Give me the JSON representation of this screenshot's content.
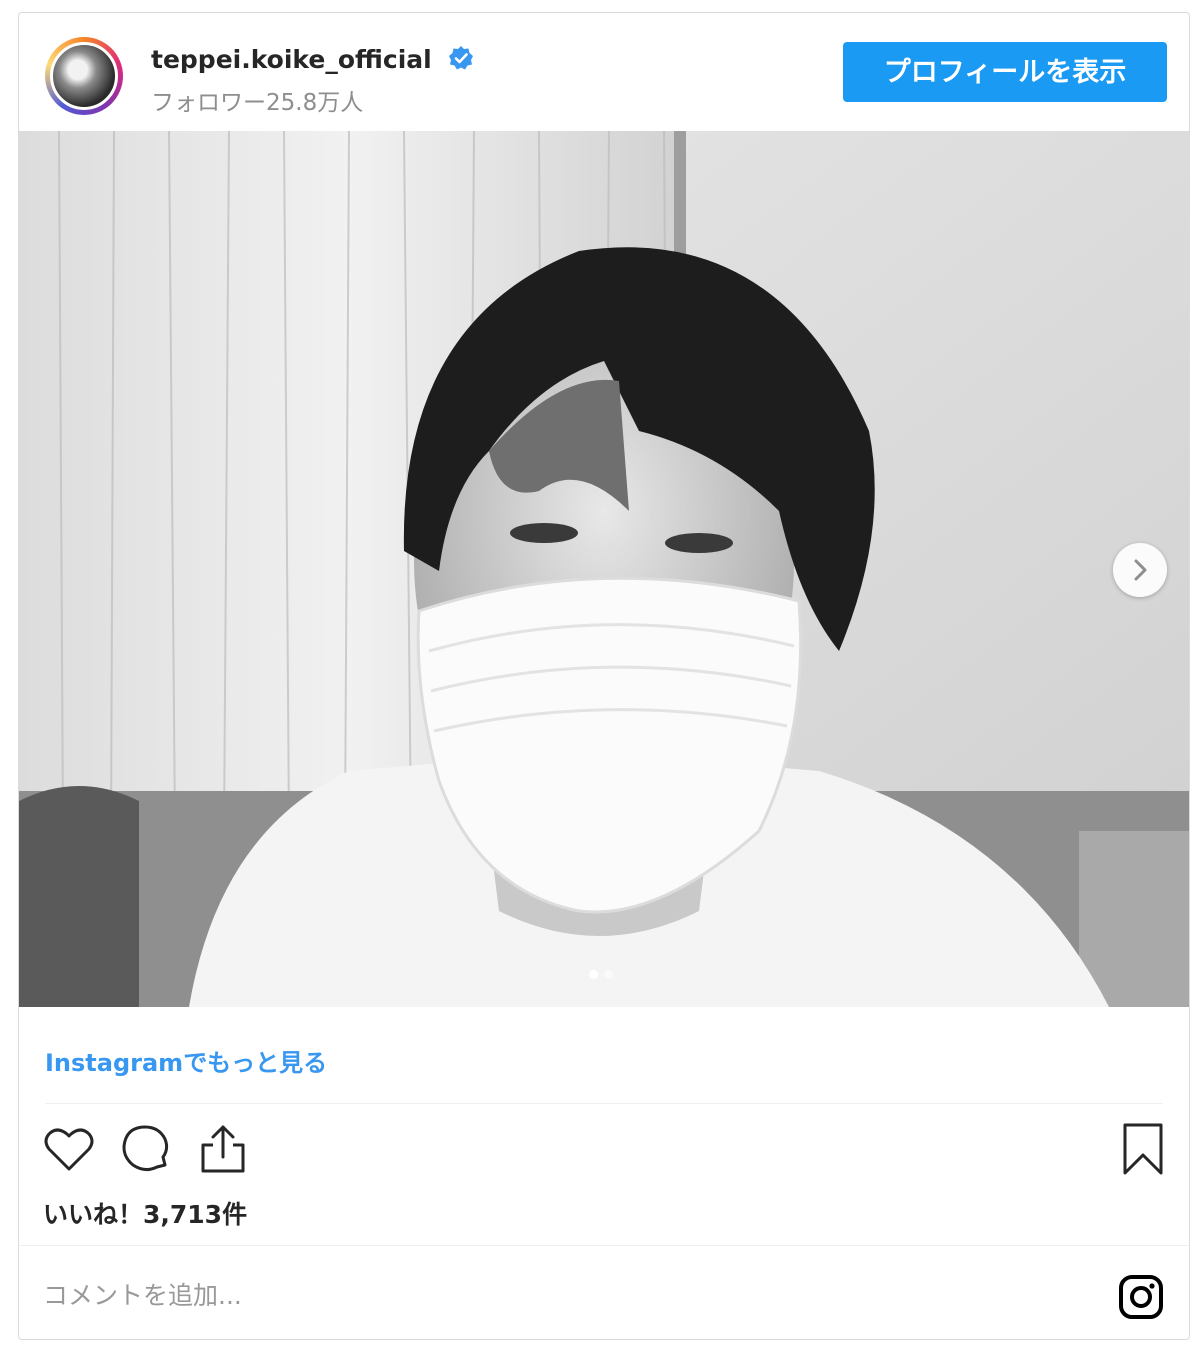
{
  "header": {
    "username": "teppei.koike_official",
    "verified_icon": "verified-badge-icon",
    "followers": "フォロワー25.8万人",
    "profile_button": "プロフィールを表示"
  },
  "media": {
    "image_description_icon": "photo",
    "next_icon": "chevron-right-icon",
    "carousel_count": 2,
    "carousel_active": 1
  },
  "links": {
    "more_on_instagram": "Instagramでもっと見る"
  },
  "actions": {
    "like_icon": "heart-icon",
    "comment_icon": "comment-icon",
    "share_icon": "share-icon",
    "save_icon": "bookmark-icon"
  },
  "likes": {
    "text": "いいね！3,713件"
  },
  "comment": {
    "placeholder": "コメントを追加..."
  },
  "colors": {
    "accent": "#1a9af2",
    "link": "#3897f0",
    "muted": "#8e8e8e",
    "border": "#dbdbdb"
  }
}
